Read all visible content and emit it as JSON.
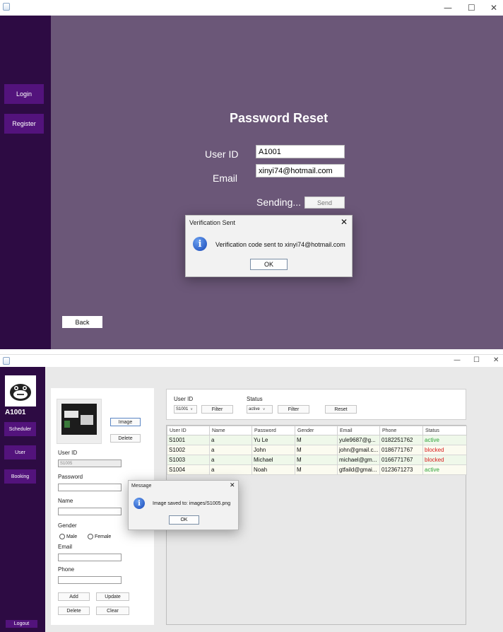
{
  "window1": {
    "sidebar": {
      "login_label": "Login",
      "register_label": "Register"
    },
    "title": "Password Reset",
    "userid_label": "User ID",
    "userid_value": "A1001",
    "email_label": "Email",
    "email_value": "xinyi74@hotmail.com",
    "sending_text": "Sending...",
    "send_label": "Send",
    "back_label": "Back",
    "dialog": {
      "title": "Verification Sent",
      "message": "Verification code sent to xinyi74@hotmail.com",
      "ok_label": "OK"
    }
  },
  "window2": {
    "sidebar": {
      "user_id": "A1001",
      "scheduler_label": "Scheduler",
      "user_label": "User",
      "booking_label": "Booking",
      "logout_label": "Logout"
    },
    "form": {
      "image_button": "Image",
      "delete_image_button": "Delete",
      "userid_label": "User ID",
      "userid_value": "S1005",
      "password_label": "Password",
      "name_label": "Name",
      "gender_label": "Gender",
      "male_label": "Male",
      "female_label": "Female",
      "email_label": "Email",
      "phone_label": "Phone",
      "add_label": "Add",
      "update_label": "Update",
      "delete_label": "Delete",
      "clear_label": "Clear"
    },
    "filters": {
      "userid_label": "User ID",
      "userid_selected": "S1001",
      "filter1_label": "Filter",
      "status_label": "Status",
      "status_selected": "active",
      "filter2_label": "Filter",
      "reset_label": "Reset"
    },
    "table": {
      "columns": [
        "User ID",
        "Name",
        "Password",
        "Gender",
        "Email",
        "Phone",
        "Status"
      ],
      "rows": [
        [
          "S1001",
          "a",
          "Yu Le",
          "M",
          "yule9687@g...",
          "0182251762",
          "active"
        ],
        [
          "S1002",
          "a",
          "John",
          "M",
          "john@gmail.c...",
          "0186771767",
          "blocked"
        ],
        [
          "S1003",
          "a",
          "Michael",
          "M",
          "michael@gm...",
          "0166771767",
          "blocked"
        ],
        [
          "S1004",
          "a",
          "Noah",
          "M",
          "gtfaild@gmai...",
          "0123671273",
          "active"
        ]
      ]
    },
    "dialog": {
      "title": "Message",
      "message": "Image saved to: images/S1005.png",
      "ok_label": "OK"
    }
  },
  "colors": {
    "sidebar": "#2d0b43",
    "main_bg": "#6b5778",
    "button_purple": "#53137c",
    "active": "#2fa33a",
    "blocked": "#d81e1e"
  }
}
